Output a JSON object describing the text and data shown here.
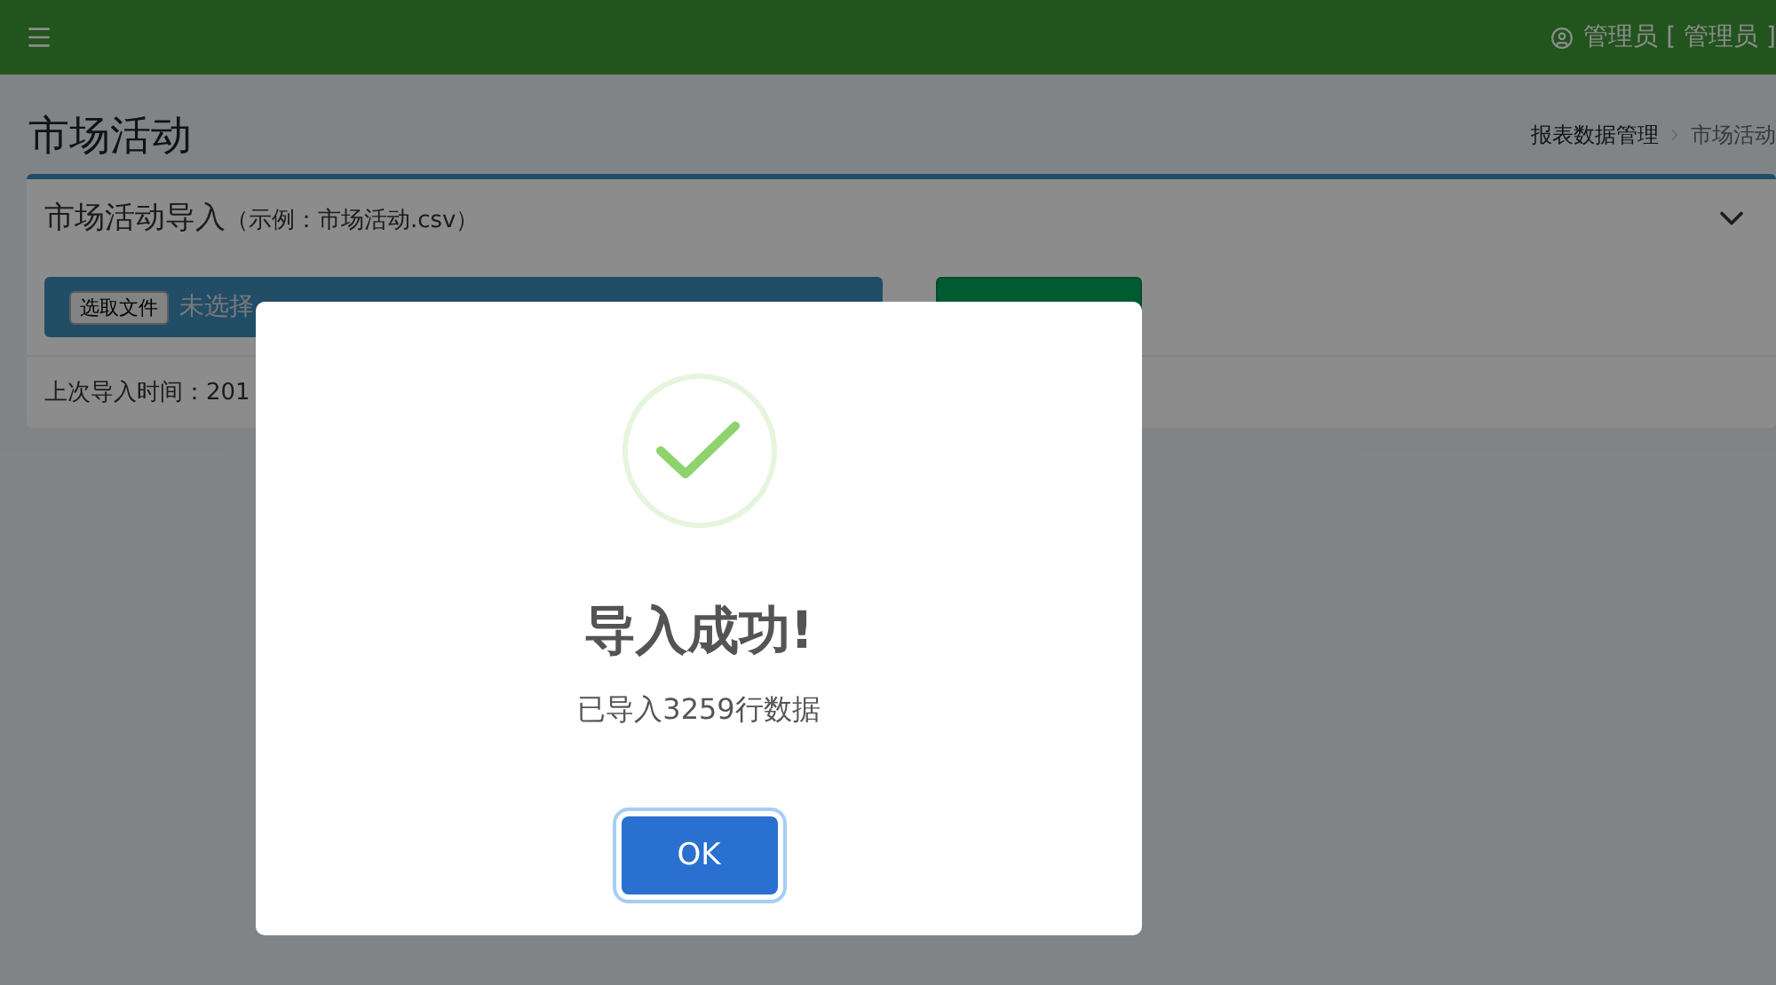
{
  "header": {
    "user": "管理员 [ 管理员 ]"
  },
  "page": {
    "title": "市场活动",
    "breadcrumb": [
      "报表数据管理",
      "市场活动"
    ]
  },
  "card": {
    "title": "市场活动导入",
    "hint": "（示例：市场活动.csv）",
    "expanded": true,
    "file_button": "选取文件",
    "file_status": "未选择",
    "last_import": "上次导入时间：201"
  },
  "dialog": {
    "title": "导入成功!",
    "message": "已导入3259行数据",
    "button": "OK"
  }
}
